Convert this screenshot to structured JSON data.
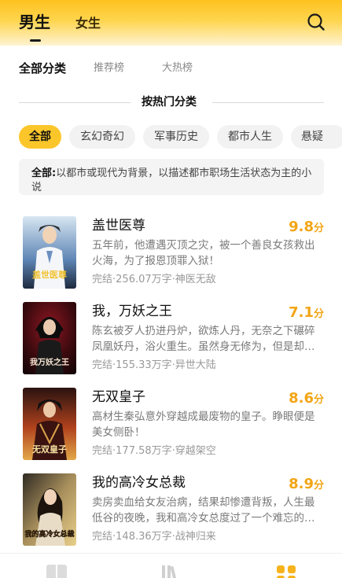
{
  "header": {
    "tabs": [
      {
        "label": "男生",
        "active": true
      },
      {
        "label": "女生",
        "active": false
      }
    ],
    "search_icon": "search-icon"
  },
  "sub_tabs": [
    {
      "label": "全部分类",
      "active": true
    },
    {
      "label": "推荐榜",
      "active": false
    },
    {
      "label": "大热榜",
      "active": false
    }
  ],
  "section_title": "按热门分类",
  "categories": [
    {
      "label": "全部",
      "active": true
    },
    {
      "label": "玄幻奇幻",
      "active": false
    },
    {
      "label": "军事历史",
      "active": false
    },
    {
      "label": "都市人生",
      "active": false
    },
    {
      "label": "悬疑",
      "active": false
    }
  ],
  "category_desc": {
    "label": "全部:",
    "text": "以都市或现代为背景，以描述都市职场生活状态为主的小说"
  },
  "books": [
    {
      "title": "盖世医尊",
      "score": "9.8",
      "score_unit": "分",
      "desc": "五年前，他遭遇灭顶之灾，被一个善良女孩救出火海，为了报恩顶罪入狱！",
      "status": "完结",
      "words": "256.07万字",
      "tag": "神医无敌",
      "cover_title": "盖世医尊",
      "cover_colors": [
        "#d7e6f2",
        "#5f86b5",
        "#1d2a3f"
      ]
    },
    {
      "title": "我，万妖之王",
      "score": "7.1",
      "score_unit": "分",
      "desc": "陈玄被歹人扔进丹炉，欲炼人丹，无奈之下碾碎凤凰妖丹，浴火重生。虽然身无修为，但是却拥有了浴火之身。",
      "status": "完结",
      "words": "155.33万字",
      "tag": "异世大陆",
      "cover_title": "我万妖之王",
      "cover_colors": [
        "#3a0a0e",
        "#8e1622",
        "#120406"
      ]
    },
    {
      "title": "无双皇子",
      "score": "8.6",
      "score_unit": "分",
      "desc": "高材生秦弘意外穿越成最废物的皇子。睁眼便是美女侧卧！",
      "status": "完结",
      "words": "177.58万字",
      "tag": "穿越架空",
      "cover_title": "无双皇子",
      "cover_colors": [
        "#2a1210",
        "#b0421d",
        "#e3a84a"
      ]
    },
    {
      "title": "我的高冷女总裁",
      "score": "8.9",
      "score_unit": "分",
      "desc": "卖房卖血给女友治病，结果却惨遭背叛，人生最低谷的夜晚，我和高冷女总度过了一个难忘的夜晚。",
      "status": "完结",
      "words": "148.36万字",
      "tag": "战神归来",
      "cover_title": "我的高冷女总裁",
      "cover_colors": [
        "#2f2a22",
        "#a88f5c",
        "#e9cf8a"
      ]
    }
  ],
  "bottom_nav": [
    {
      "icon": "bookshelf-icon",
      "active": false
    },
    {
      "icon": "library-icon",
      "active": false
    },
    {
      "icon": "category-icon",
      "active": true,
      "color": "#f7b31d"
    }
  ],
  "colors": {
    "accent": "#fbc62a",
    "score": "#f2a516"
  }
}
